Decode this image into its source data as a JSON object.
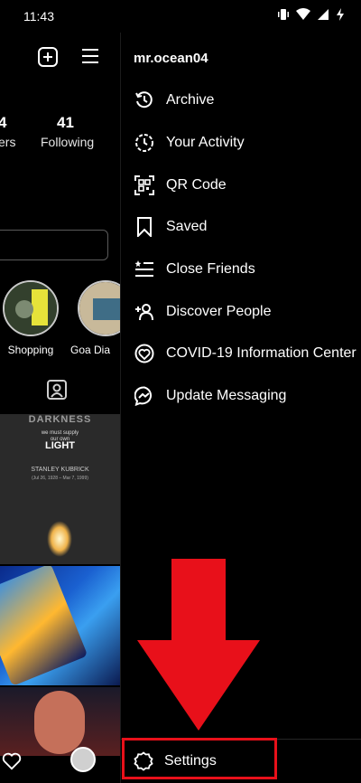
{
  "status_bar": {
    "time": "11:43"
  },
  "profile_bg": {
    "followers_num": "4",
    "followers_label": "ers",
    "following_num": "41",
    "following_label": "Following",
    "highlights": [
      {
        "label": "Shopping"
      },
      {
        "label": "Goa Dia"
      }
    ],
    "post_text": {
      "line1": "DARKNESS",
      "line2": "we must supply",
      "line3": "our own",
      "line4": "LIGHT",
      "line5": "STANLEY KUBRICK",
      "line6": "(Jul 26, 1928 – Mar 7, 1999)"
    }
  },
  "drawer": {
    "username": "mr.ocean04",
    "items": [
      {
        "label": "Archive",
        "icon": "archive-icon"
      },
      {
        "label": "Your Activity",
        "icon": "activity-icon"
      },
      {
        "label": "QR Code",
        "icon": "qr-code-icon"
      },
      {
        "label": "Saved",
        "icon": "bookmark-icon"
      },
      {
        "label": "Close Friends",
        "icon": "close-friends-icon"
      },
      {
        "label": "Discover People",
        "icon": "add-person-icon"
      },
      {
        "label": "COVID-19 Information Center",
        "icon": "covid-info-icon"
      },
      {
        "label": "Update Messaging",
        "icon": "messenger-icon"
      }
    ],
    "settings_label": "Settings"
  },
  "colors": {
    "highlight_red": "#e8101a",
    "background": "#000000"
  }
}
